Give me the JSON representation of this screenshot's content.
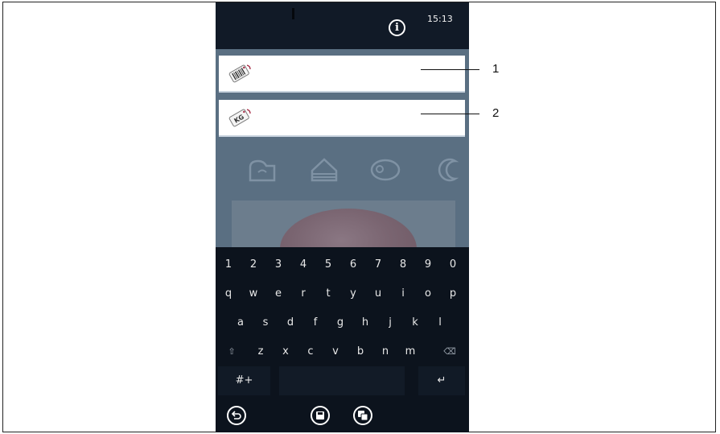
{
  "status_bar": {
    "time": "15:13",
    "info_icon": "info-icon"
  },
  "fields": [
    {
      "icon": "barcode-tag-icon",
      "value": "",
      "placeholder": ""
    },
    {
      "icon": "kg-tag-icon",
      "value": "",
      "placeholder": ""
    }
  ],
  "categories": [
    {
      "icon": "bread-icon"
    },
    {
      "icon": "cake-icon"
    },
    {
      "icon": "steak-icon"
    },
    {
      "icon": "croissant-icon"
    }
  ],
  "keyboard": {
    "row1": [
      "1",
      "2",
      "3",
      "4",
      "5",
      "6",
      "7",
      "8",
      "9",
      "0"
    ],
    "row2": [
      "q",
      "w",
      "e",
      "r",
      "t",
      "y",
      "u",
      "i",
      "o",
      "p"
    ],
    "row3": [
      "a",
      "s",
      "d",
      "f",
      "g",
      "h",
      "j",
      "k",
      "l"
    ],
    "row4": [
      "⇧",
      "z",
      "x",
      "c",
      "v",
      "b",
      "n",
      "m",
      "⌫"
    ],
    "symbols_label": "#+",
    "enter_label": "↵"
  },
  "nav": [
    {
      "icon": "back-icon"
    },
    {
      "icon": "save-icon"
    },
    {
      "icon": "save-as-icon"
    }
  ],
  "callouts": [
    "1",
    "2"
  ]
}
